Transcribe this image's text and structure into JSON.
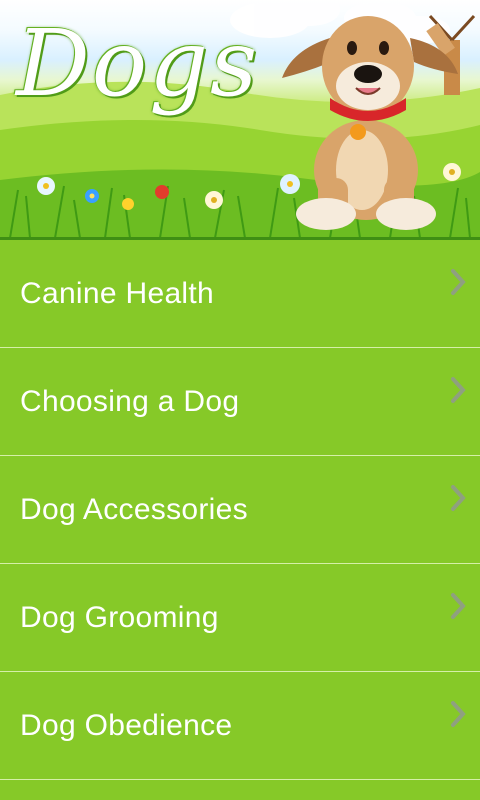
{
  "header": {
    "title": "Dogs",
    "illustration": "cartoon dog in meadow with windmill"
  },
  "menu": {
    "items": [
      {
        "label": "Canine Health",
        "icon": "chevron-right-icon"
      },
      {
        "label": "Choosing a Dog",
        "icon": "chevron-right-icon"
      },
      {
        "label": "Dog Accessories",
        "icon": "chevron-right-icon"
      },
      {
        "label": "Dog Grooming",
        "icon": "chevron-right-icon"
      },
      {
        "label": "Dog Obedience",
        "icon": "chevron-right-icon"
      }
    ]
  },
  "colors": {
    "background": "#86c928",
    "divider": "#d5efa8",
    "text": "#ffffff",
    "chevron": "#8fa080"
  }
}
